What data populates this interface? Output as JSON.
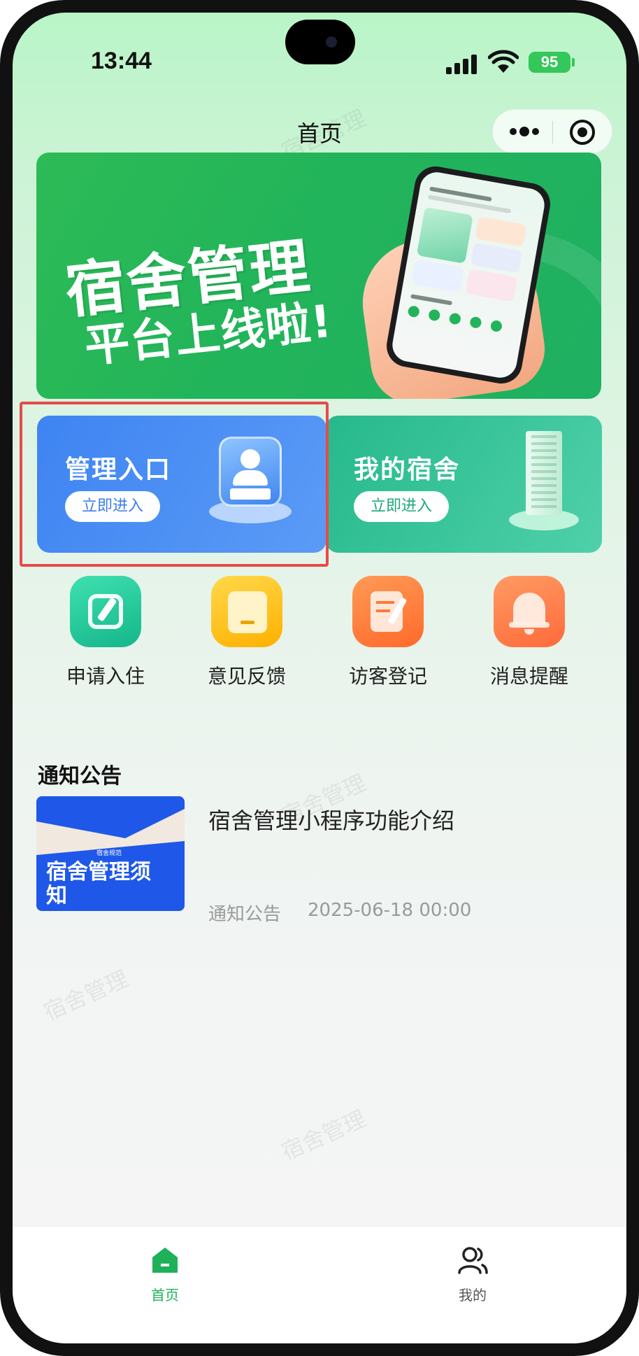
{
  "status_bar": {
    "time": "13:44",
    "battery": "95"
  },
  "nav": {
    "title": "首页"
  },
  "banner": {
    "line1": "宿舍管理",
    "line2": "平台上线啦!"
  },
  "entries": [
    {
      "title": "管理入口",
      "button": "立即进入"
    },
    {
      "title": "我的宿舍",
      "button": "立即进入"
    }
  ],
  "quick_actions": [
    {
      "label": "申请入住",
      "icon": "edit-icon"
    },
    {
      "label": "意见反馈",
      "icon": "feedback-icon"
    },
    {
      "label": "访客登记",
      "icon": "notebook-icon"
    },
    {
      "label": "消息提醒",
      "icon": "bell-icon"
    }
  ],
  "notices": {
    "section_title": "通知公告",
    "items": [
      {
        "title": "宿舍管理小程序功能介绍",
        "category": "通知公告",
        "time": "2025-06-18 00:00",
        "thumb_small": "宿舍规范",
        "thumb_big": "宿舍管理须知"
      }
    ]
  },
  "watermark": "宿舍管理",
  "tabbar": [
    {
      "label": "首页",
      "icon": "home-icon",
      "active": true
    },
    {
      "label": "我的",
      "icon": "users-icon",
      "active": false
    }
  ],
  "colors": {
    "accent": "#1fb15a",
    "highlight": "#e84a4a",
    "admin_card": "#3e84f2",
    "dorm_card": "#26b98b"
  }
}
